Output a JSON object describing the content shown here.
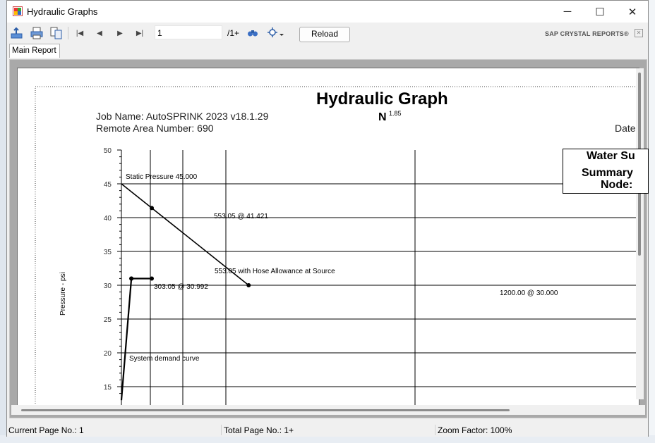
{
  "window": {
    "title": "Hydraulic Graphs",
    "minimize_glyph": "─",
    "maximize_glyph": "☐",
    "close_glyph": "✕"
  },
  "toolbar": {
    "icons": [
      "export-icon",
      "print-icon",
      "copy-icon",
      "first-page-icon",
      "prev-page-icon",
      "next-page-icon",
      "last-page-icon",
      "find-icon",
      "zoom-icon"
    ],
    "page_value": "1",
    "page_total": "/1+",
    "reload_label": "Reload",
    "brand": "SAP CRYSTAL REPORTS®",
    "brand_close": "✕"
  },
  "tabs": [
    {
      "label": "Main Report"
    }
  ],
  "report": {
    "title": "Hydraulic Graph",
    "job_name": "Job Name: AutoSPRINK 2023 v18.1.29",
    "remote_area": "Remote Area Number: 690",
    "n_label": "N",
    "n_exponent": "1.85",
    "date_label": "Date",
    "summary_line1": "Water Su",
    "summary_line2": "Summary",
    "summary_line3": "Node:"
  },
  "chart_data": {
    "type": "line",
    "ylabel": "Pressure - psi",
    "y_ticks": [
      "50",
      "45",
      "40",
      "35",
      "30",
      "25",
      "20",
      "15"
    ],
    "ylim": [
      15,
      50
    ],
    "annotations": [
      "Static Pressure 45.000",
      "553.05 @ 41.421",
      "553.05 with Hose Allowance at Source",
      "303.05 @ 30.992",
      "1200.00 @ 30.000",
      "System demand curve"
    ],
    "series": [
      {
        "values": [
          [
            0,
            45.0
          ],
          [
            553.05,
            41.421
          ],
          [
            1200.0,
            30.0
          ]
        ]
      },
      {
        "values": [
          [
            303.05,
            30.992
          ],
          [
            553.05,
            30.992
          ]
        ]
      },
      {
        "values": [
          [
            0,
            13.0
          ],
          [
            303.05,
            30.992
          ]
        ]
      }
    ],
    "grid": true
  },
  "status": {
    "current_page": "Current Page No.: 1",
    "total_page": "Total Page No.: 1+",
    "zoom": "Zoom Factor: 100%"
  }
}
